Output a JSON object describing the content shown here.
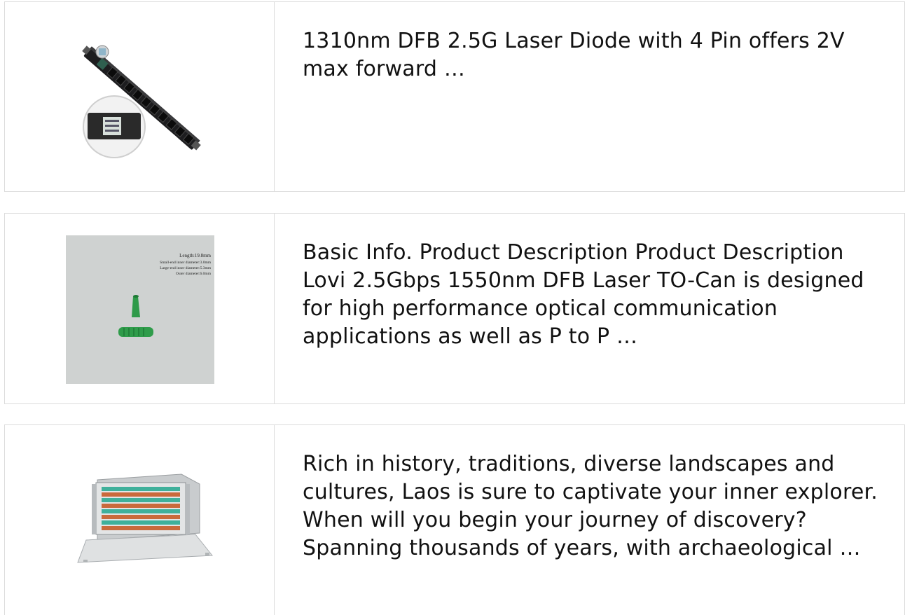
{
  "products": [
    {
      "image_icon": "power-distribution-unit-photo",
      "description": "1310nm DFB 2.5G Laser Diode with 4 Pin offers 2V max forward …"
    },
    {
      "image_icon": "green-cable-boot-photo",
      "image_labels": [
        "Length:19.8mm",
        "Small-end inner diameter:3.0mm",
        "Large-end inner diameter:5.3mm",
        "Outer diameter:6.0mm"
      ],
      "description": "Basic Info. Product Description Product Description Lovi 2.5Gbps 1550nm DFB Laser TO-Can is designed for high performance optical communication applications as well as P to P …"
    },
    {
      "image_icon": "fiber-patch-panel-photo",
      "description": "Rich in history, traditions, diverse landscapes and cultures, Laos is sure to captivate your inner explorer. When will you begin your journey of discovery? Spanning thousands of years, with archaeological …"
    }
  ]
}
